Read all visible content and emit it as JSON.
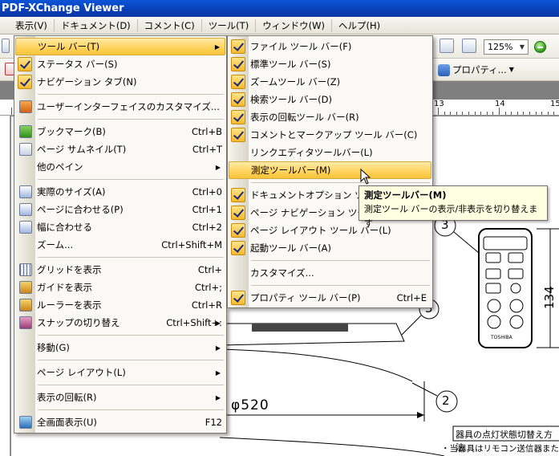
{
  "window": {
    "title": "PDF-XChange Viewer"
  },
  "menubar": [
    {
      "label": "表示(V)",
      "active": true
    },
    {
      "label": "ドキュメント(D)"
    },
    {
      "label": "コメント(C)"
    },
    {
      "label": "ツール(T)"
    },
    {
      "label": "ウィンドウ(W)"
    },
    {
      "label": "ヘルプ(H)"
    }
  ],
  "toolbar": {
    "zoom_value": "125%",
    "properties_label": "プロパティ..."
  },
  "ruler": {
    "numbers": [
      "13",
      "14",
      "15"
    ]
  },
  "view_menu": {
    "items": [
      {
        "label": "ツール バー(T)",
        "submenu": true,
        "highlighted": true
      },
      {
        "label": "ステータス バー(S)",
        "checked": true
      },
      {
        "label": "ナビゲーション タブ(N)",
        "checked": true
      },
      {
        "sep": true
      },
      {
        "label": "ユーザーインターフェイスのカスタマイズ...",
        "icon": "customize-icon"
      },
      {
        "sep": true
      },
      {
        "label": "ブックマーク(B)",
        "shortcut": "Ctrl+B",
        "icon": "bookmark-icon"
      },
      {
        "label": "ページ サムネイル(T)",
        "shortcut": "Ctrl+T",
        "icon": "thumbnail-icon"
      },
      {
        "label": "他のペイン",
        "submenu": true
      },
      {
        "sep": true
      },
      {
        "label": "実際のサイズ(A)",
        "shortcut": "Ctrl+0",
        "icon": "actual-size-icon"
      },
      {
        "label": "ページに合わせる(P)",
        "shortcut": "Ctrl+1",
        "icon": "fit-page-icon"
      },
      {
        "label": "幅に合わせる",
        "shortcut": "Ctrl+2",
        "icon": "fit-width-icon"
      },
      {
        "label": "ズーム...",
        "shortcut": "Ctrl+Shift+M"
      },
      {
        "sep": true
      },
      {
        "label": "グリッドを表示",
        "shortcut": "Ctrl+",
        "icon": "grid-icon"
      },
      {
        "label": "ガイドを表示",
        "shortcut": "Ctrl+;",
        "icon": "guide-icon"
      },
      {
        "label": "ルーラーを表示",
        "shortcut": "Ctrl+R",
        "icon": "ruler-icon"
      },
      {
        "label": "スナップの切り替え",
        "shortcut": "Ctrl+Shift+:",
        "submenu": true,
        "icon": "snap-icon"
      },
      {
        "sep": true
      },
      {
        "label": "移動(G)",
        "submenu": true
      },
      {
        "sep": true
      },
      {
        "label": "ページ レイアウト(L)",
        "submenu": true
      },
      {
        "sep": true
      },
      {
        "label": "表示の回転(R)",
        "submenu": true
      },
      {
        "sep": true
      },
      {
        "label": "全画面表示(U)",
        "shortcut": "F12",
        "icon": "fullscreen-icon"
      }
    ]
  },
  "toolbar_submenu": {
    "items": [
      {
        "label": "ファイル ツール バー(F)",
        "checked": true
      },
      {
        "label": "標準ツール バー(S)",
        "checked": true
      },
      {
        "label": "ズームツール バー(Z)",
        "checked": true
      },
      {
        "label": "検索ツール バー(D)",
        "checked": true
      },
      {
        "label": "表示の回転ツール バー(R)",
        "checked": true
      },
      {
        "label": "コメントとマークアップ ツール バー(C)",
        "checked": true
      },
      {
        "label": "リンクエディタツールバー(L)"
      },
      {
        "label": "測定ツールバー(M)",
        "highlighted": true
      },
      {
        "sep": true
      },
      {
        "label": "ドキュメントオプション ツール",
        "checked": true
      },
      {
        "label": "ページ ナビゲーション ツール",
        "checked": true
      },
      {
        "label": "ページ レイアウト ツール バー(L)",
        "checked": true
      },
      {
        "label": "起動ツール バー(A)",
        "checked": true
      },
      {
        "sep": true
      },
      {
        "label": "カスタマイズ..."
      },
      {
        "sep": true
      },
      {
        "label": "プロパティ ツール バー(P)",
        "shortcut": "Ctrl+E",
        "checked": true
      }
    ]
  },
  "tooltip": {
    "title": "測定ツールバー(M)",
    "description": "測定ツール バーの表示/非表示を切り替えます"
  },
  "drawing": {
    "dimension_diameter": "φ520",
    "dimension_height": "134",
    "callout_2": "2",
    "callout_3": "3",
    "note_title": "器具の点灯状態切替え方法",
    "note_line1": "・当器具はリモコン送信器または壁ス",
    "remote_brand": "TOSHIBA"
  },
  "colors": {
    "title_bar": "#0a3fb5",
    "menu_highlight": "#ffd25b",
    "tooltip_bg": "#ffffe1"
  }
}
